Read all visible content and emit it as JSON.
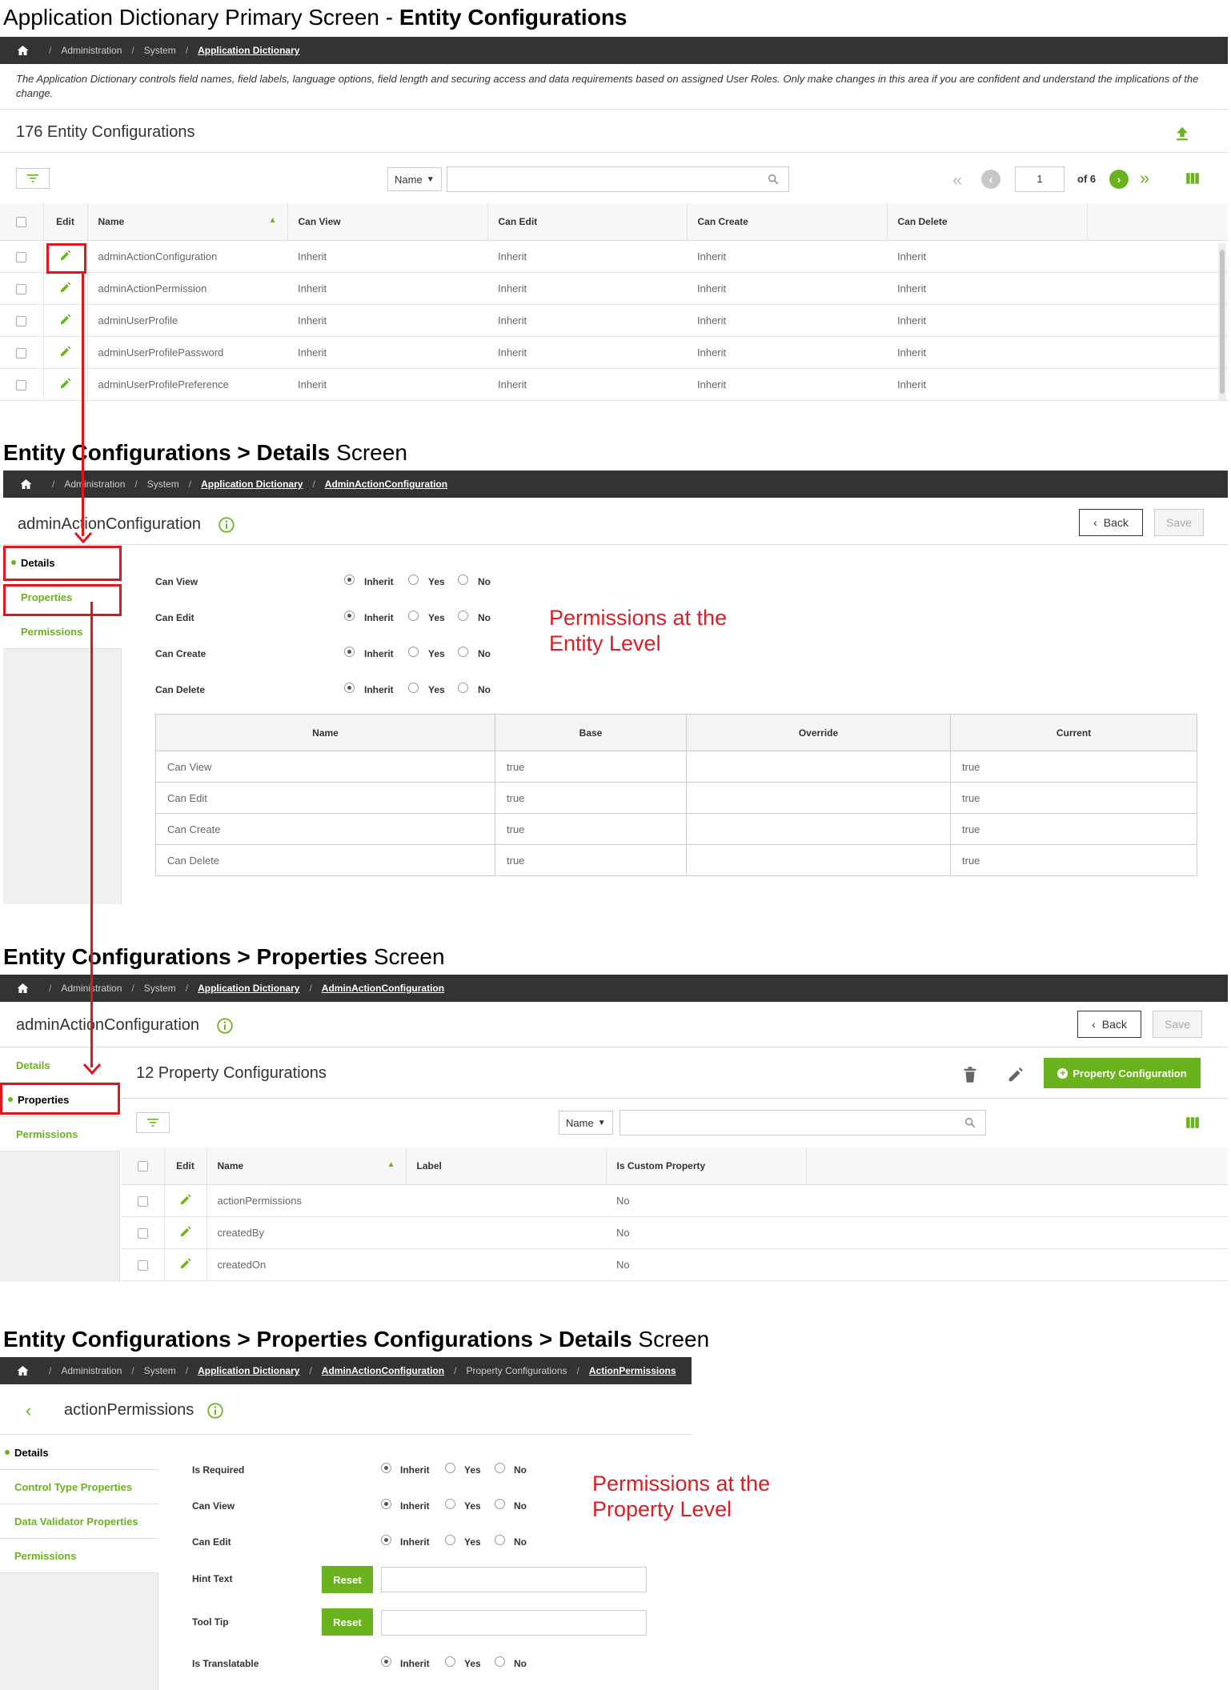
{
  "headings": {
    "h1_plain": "Application Dictionary Primary Screen - ",
    "h1_bold": "Entity Configurations",
    "h2_bold": "Entity Configurations > Details",
    "h2_plain": " Screen",
    "h3_bold": "Entity Configurations > Properties",
    "h3_plain": " Screen",
    "h4_bold": "Entity Configurations > Properties Configurations > Details",
    "h4_plain": " Screen"
  },
  "crumbs": {
    "administration": "Administration",
    "system": "System",
    "app_dict": "Application Dictionary",
    "admin_action_config": "AdminActionConfiguration",
    "property_configurations": "Property Configurations",
    "action_permissions": "ActionPermissions",
    "sep": "/"
  },
  "screen1": {
    "description": "The Application Dictionary controls field names, field labels, language options, field length and securing access and data requirements based on assigned User Roles. Only make changes in this area if you are confident and understand the implications of the change.",
    "count_title": "176 Entity Configurations",
    "filter_select": "Name",
    "page_value": "1",
    "page_of": "of 6",
    "columns": [
      "Edit",
      "Name",
      "Can View",
      "Can Edit",
      "Can Create",
      "Can Delete"
    ],
    "rows": [
      {
        "name": "adminActionConfiguration",
        "view": "Inherit",
        "edit": "Inherit",
        "create": "Inherit",
        "del": "Inherit"
      },
      {
        "name": "adminActionPermission",
        "view": "Inherit",
        "edit": "Inherit",
        "create": "Inherit",
        "del": "Inherit"
      },
      {
        "name": "adminUserProfile",
        "view": "Inherit",
        "edit": "Inherit",
        "create": "Inherit",
        "del": "Inherit"
      },
      {
        "name": "adminUserProfilePassword",
        "view": "Inherit",
        "edit": "Inherit",
        "create": "Inherit",
        "del": "Inherit"
      },
      {
        "name": "adminUserProfilePreference",
        "view": "Inherit",
        "edit": "Inherit",
        "create": "Inherit",
        "del": "Inherit"
      }
    ]
  },
  "screen2": {
    "title": "adminActionConfiguration",
    "back": "Back",
    "save": "Save",
    "nav": [
      "Details",
      "Properties",
      "Permissions"
    ],
    "perm_labels": [
      "Can View",
      "Can Edit",
      "Can Create",
      "Can Delete"
    ],
    "options": [
      "Inherit",
      "Yes",
      "No"
    ],
    "annotation": "Permissions at the Entity Level",
    "table_headers": [
      "Name",
      "Base",
      "Override",
      "Current"
    ],
    "table_rows": [
      {
        "name": "Can View",
        "base": "true",
        "override": "",
        "current": "true"
      },
      {
        "name": "Can Edit",
        "base": "true",
        "override": "",
        "current": "true"
      },
      {
        "name": "Can Create",
        "base": "true",
        "override": "",
        "current": "true"
      },
      {
        "name": "Can Delete",
        "base": "true",
        "override": "",
        "current": "true"
      }
    ]
  },
  "screen3": {
    "title": "adminActionConfiguration",
    "back": "Back",
    "save": "Save",
    "nav": [
      "Details",
      "Properties",
      "Permissions"
    ],
    "count_title": "12 Property Configurations",
    "add_button": "Property Configuration",
    "filter_select": "Name",
    "columns": [
      "Edit",
      "Name",
      "Label",
      "Is Custom Property"
    ],
    "rows": [
      {
        "name": "actionPermissions",
        "label": "",
        "custom": "No"
      },
      {
        "name": "createdBy",
        "label": "",
        "custom": "No"
      },
      {
        "name": "createdOn",
        "label": "",
        "custom": "No"
      }
    ]
  },
  "screen4": {
    "title": "actionPermissions",
    "nav": [
      "Details",
      "Control Type Properties",
      "Data Validator Properties",
      "Permissions"
    ],
    "perm_labels": [
      "Is Required",
      "Can View",
      "Can Edit"
    ],
    "hint_label": "Hint Text",
    "tooltip_label": "Tool Tip",
    "reset": "Reset",
    "translatable_label": "Is Translatable",
    "options": [
      "Inherit",
      "Yes",
      "No"
    ],
    "annotation": "Permissions at the Property Level"
  },
  "colors": {
    "accent": "#6ab31f",
    "header_bar": "#333333",
    "annotation": "#e0161e"
  }
}
